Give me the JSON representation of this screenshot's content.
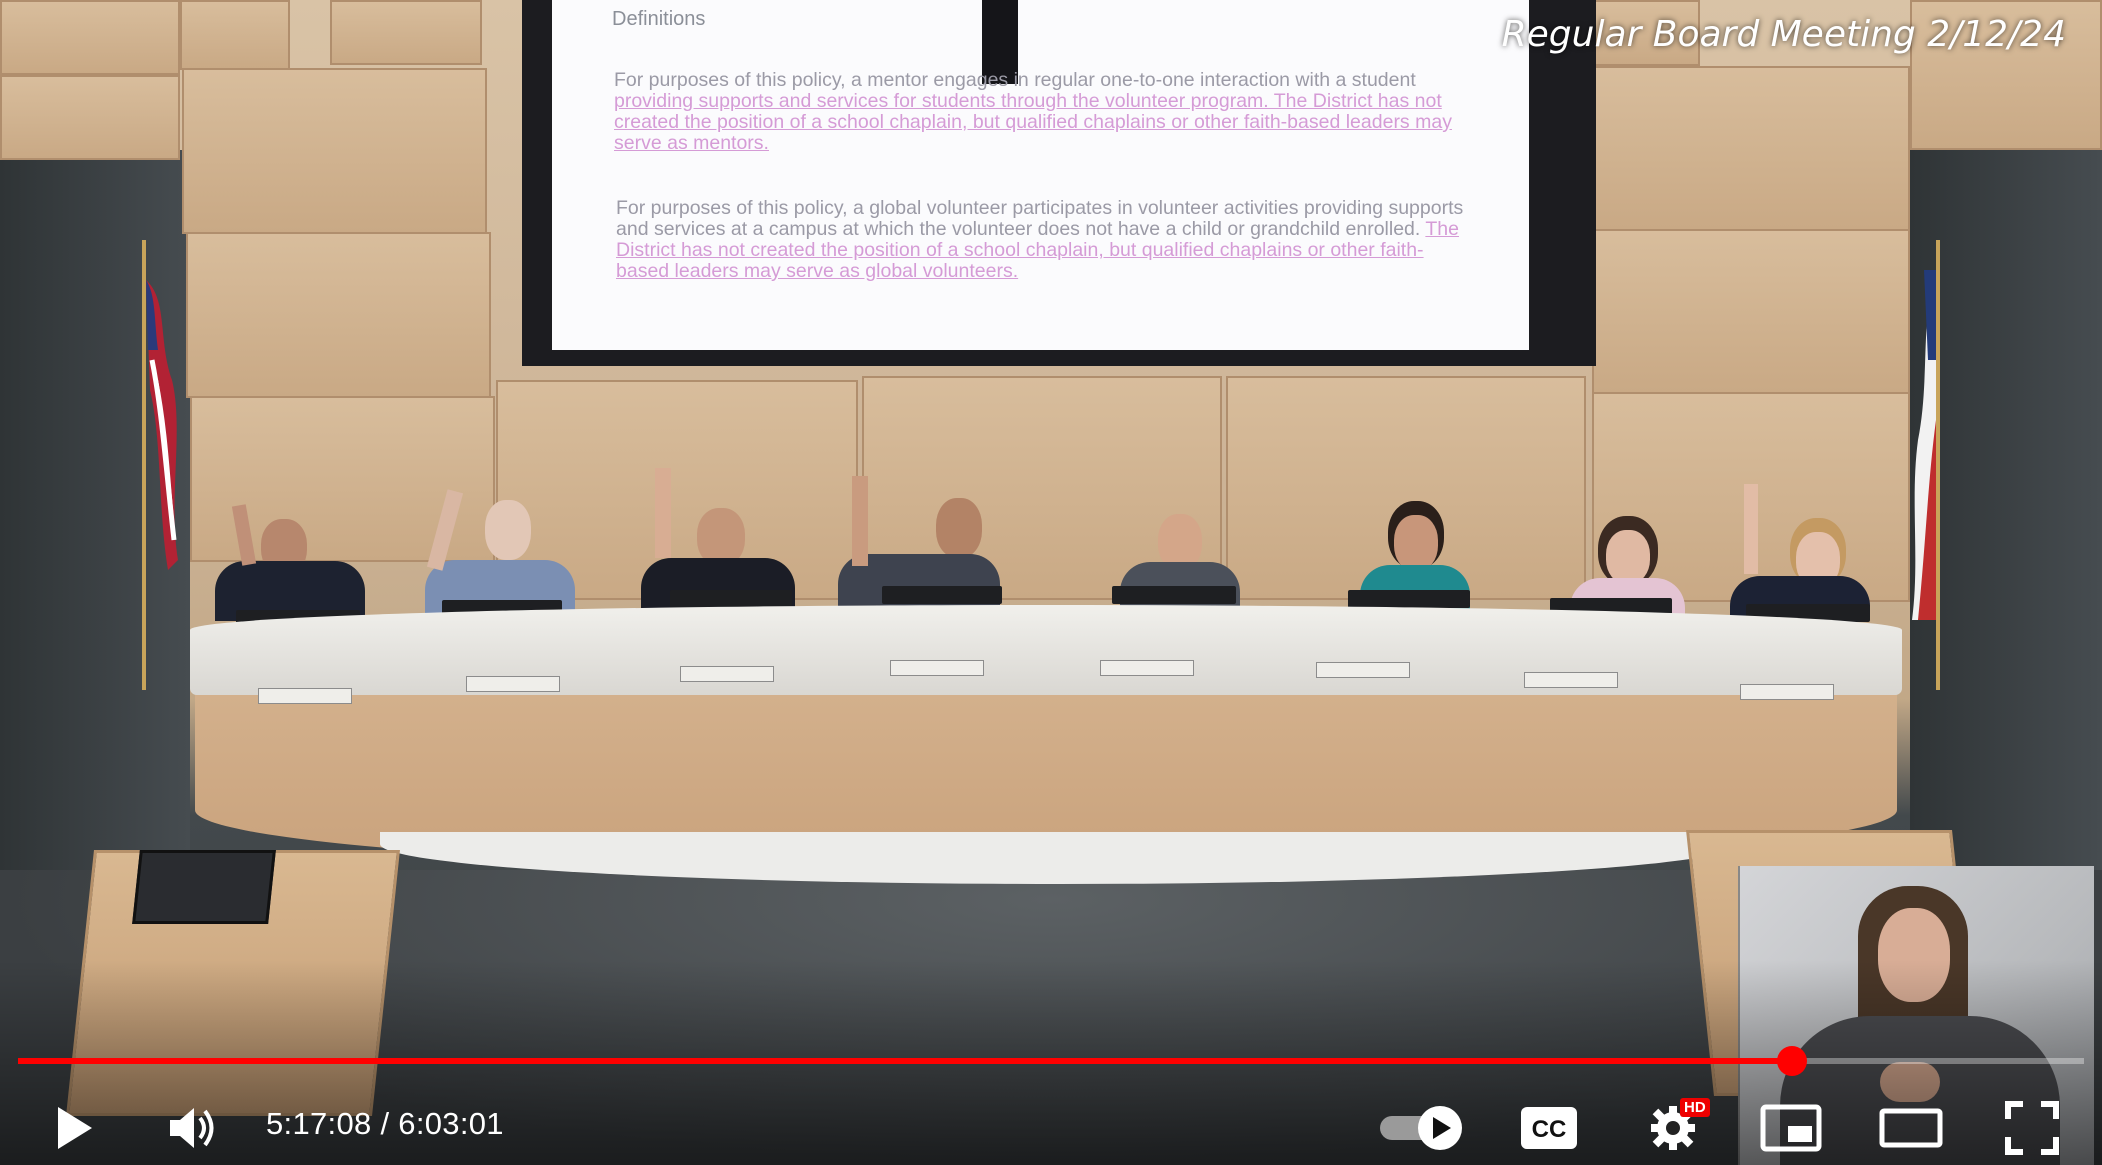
{
  "player": {
    "watermark": "Regular Board Meeting  2/12/24",
    "time_current": "5:17:08",
    "time_separator": " / ",
    "time_total": "6:03:01",
    "progress_fraction": 0.8587,
    "accent_color": "#ff0000",
    "hd_badge": "HD",
    "cc_label": "CC",
    "buttons": [
      "play-icon",
      "volume-icon",
      "autoplay-toggle",
      "cc-icon",
      "settings-icon",
      "miniplayer-icon",
      "theater-icon",
      "fullscreen-icon"
    ]
  },
  "slide": {
    "heading": "Definitions",
    "para1_plain": "For purposes of this policy, a mentor engages in regular one-to-one interaction with a student ",
    "para1_insert": "providing supports and services for students through the volunteer program. The District has not created the position of a school chaplain, but qualified chaplains or other faith-based leaders may serve as mentors.",
    "para2_plain": "For purposes of this policy, a global volunteer participates in volunteer activities providing supports and services at a campus at which the volunteer does not have a child or grandchild enrolled. ",
    "para2_insert": "The District has not created the position of a school chaplain, but qualified chaplains or other faith-based leaders may serve as global volunteers."
  }
}
